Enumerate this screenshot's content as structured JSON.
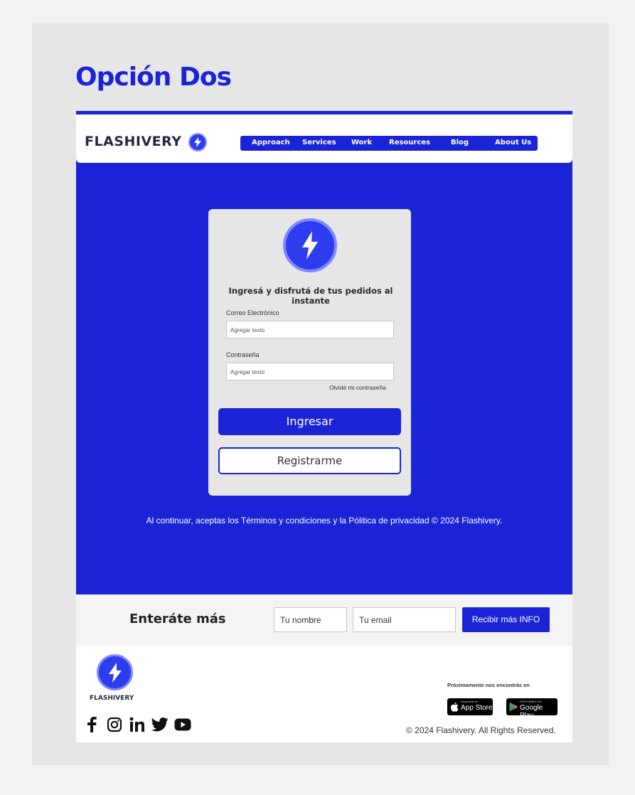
{
  "page": {
    "option_title": "Opción Dos"
  },
  "header": {
    "brand": "FLASHIVERY",
    "nav": [
      "Approach",
      "Services",
      "Work",
      "Resources",
      "Blog",
      "About Us"
    ]
  },
  "login": {
    "title": "Ingresá y disfrutá de tus pedidos al instante",
    "email_label": "Correo Electrónico",
    "email_placeholder": "Agregar texto",
    "password_label": "Contraseña",
    "password_placeholder": "Agregar texto",
    "forgot": "Olvidé mi contraseña",
    "login_button": "Ingresar",
    "register_button": "Registrarme"
  },
  "legal": "Al continuar, aceptas los Términos y condiciones y la Pólitica de privacidad © 2024 Flashivery.",
  "newsletter": {
    "title": "Enteráte más",
    "name_placeholder": "Tu nombre",
    "email_placeholder": "Tu email",
    "button": "Recibir más INFO"
  },
  "footer": {
    "brand": "FLASHIVERY",
    "socials": [
      "facebook-icon",
      "instagram-icon",
      "linkedin-icon",
      "twitter-icon",
      "youtube-icon"
    ],
    "soon": "Próximamente nos encontrás en",
    "app_store_small": "Disponible en",
    "app_store": "App Store",
    "google_play_small": "DISPONIBLE EN",
    "google_play": "Google Play",
    "copyright": "© 2024 Flashivery. All Rights Reserved."
  },
  "colors": {
    "primary": "#1a24d6",
    "accent": "#2e3cf0",
    "ring": "#7f88ff",
    "card": "#e6e6e6"
  }
}
